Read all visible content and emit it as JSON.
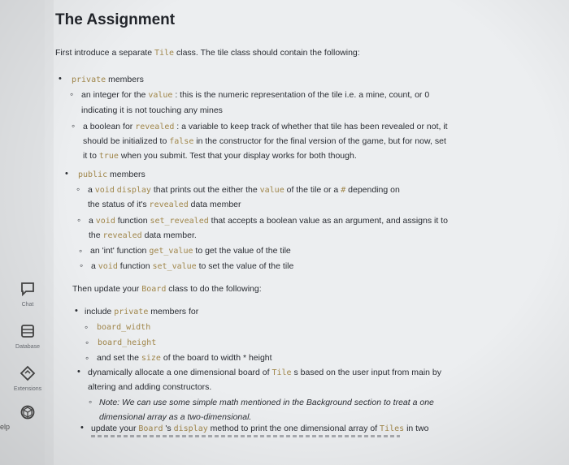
{
  "sidebar": {
    "items": [
      {
        "label": "Chat",
        "icon": "chat-icon"
      },
      {
        "label": "Database",
        "icon": "database-icon"
      },
      {
        "label": "Extensions",
        "icon": "extensions-icon"
      },
      {
        "label": "",
        "icon": "package-icon"
      }
    ],
    "help": "elp"
  },
  "assignment": {
    "title": "The Assignment",
    "intro": {
      "a": "First introduce a separate ",
      "code": "Tile",
      "b": " class. The tile class should contain the following:"
    },
    "private": {
      "code": "private",
      "text": " members"
    },
    "value_item": {
      "a": "an integer for the ",
      "code": "value",
      "b": " : this is the numeric representation of the tile i.e. a mine, count, or 0",
      "line2": "indicating it is not touching any mines"
    },
    "revealed_item": {
      "a": "a boolean for ",
      "code": "revealed",
      "b": " : a variable to keep track of whether that tile has been revealed or not, it",
      "c": "should be initialized to ",
      "code2": "false",
      "d": " in the constructor for the final version of the game, but for now, set",
      "e": "it to ",
      "code3": "true",
      "f": " when you submit. Test that your display works for both though."
    },
    "public": {
      "code": "public",
      "text": " members"
    },
    "display_item": {
      "code1": "void",
      "code2": "display",
      "a": " that prints out the either the ",
      "code3": "value",
      "b": " of the tile or a ",
      "code4": "#",
      "c": " depending on",
      "pre": "a ",
      "sp": " ",
      "line2a": "the status of it's ",
      "code5": "revealed",
      "line2b": " data member"
    },
    "set_revealed_item": {
      "pre": "a ",
      "code1": "void",
      "a": " function ",
      "code2": "set_revealed",
      "b": " that accepts a boolean value as an argument, and assigns it to",
      "line2a": "the ",
      "code3": "revealed",
      "line2b": " data member."
    },
    "get_value_item": {
      "a": "an 'int' function ",
      "code": "get_value",
      "b": " to get the value of the tile"
    },
    "set_value_item": {
      "pre": "a ",
      "code1": "void",
      "a": " function ",
      "code2": "set_value",
      "b": " to set the value of the tile"
    },
    "then": {
      "a": "Then update your ",
      "code": "Board",
      "b": " class to do the following:"
    },
    "include_private": {
      "a": "include ",
      "code": "private",
      "b": " members for"
    },
    "board_width": "board_width",
    "board_height": "board_height",
    "size_item": {
      "a": "and set the ",
      "code": "size",
      "b": " of the board to width * height"
    },
    "dynamic_item": {
      "a": "dynamically allocate a one dimensional board of ",
      "code": "Tile",
      "b": " s based on the user input from main by",
      "line2": "altering and adding constructors."
    },
    "note": {
      "line1": "Note: We can use some simple math mentioned in the Background section to treat a one",
      "line2": "dimensional array as a two-dimensional."
    },
    "update_item": {
      "a": "update your ",
      "code1": "Board",
      "b": " 's ",
      "code2": "display",
      "c": " method to print the one dimensional array of ",
      "code3": "Tiles",
      "d": " in two"
    }
  }
}
